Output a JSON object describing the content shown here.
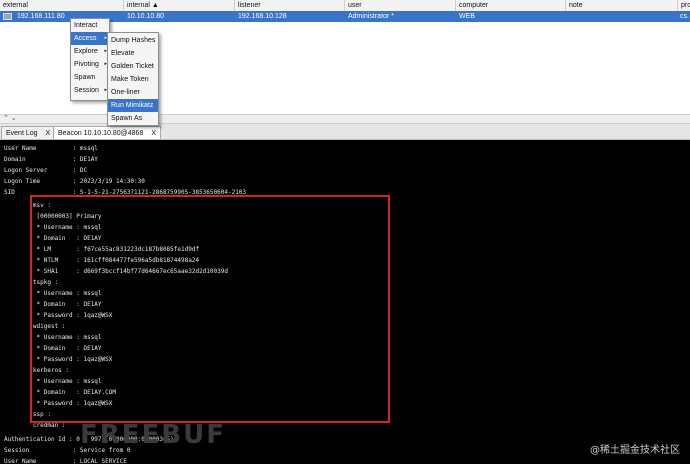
{
  "table": {
    "columns": [
      {
        "label": "external"
      },
      {
        "label": "internal ▲"
      },
      {
        "label": "listener"
      },
      {
        "label": "user"
      },
      {
        "label": "computer"
      },
      {
        "label": "note"
      },
      {
        "label": "pro"
      }
    ],
    "row": {
      "external": "192.168.111.80",
      "internal": "10.10.10.80",
      "listener": "192.168.10.128",
      "user": "Administrator *",
      "computer": "WEB",
      "process": "cs."
    }
  },
  "split_handle": "⌃ ⌄",
  "tabs": [
    {
      "label": "Event Log",
      "close": "X"
    },
    {
      "label": "Beacon 10.10.10.80@4868",
      "close": "X"
    }
  ],
  "menu_main": [
    {
      "label": "Interact",
      "arrow": ""
    },
    {
      "label": "Access",
      "arrow": "▸"
    },
    {
      "label": "Explore",
      "arrow": "▸"
    },
    {
      "label": "Pivoting",
      "arrow": "▸"
    },
    {
      "label": "Spawn",
      "arrow": ""
    },
    {
      "label": "Session",
      "arrow": "▸"
    }
  ],
  "menu_access": [
    {
      "label": "Dump Hashes"
    },
    {
      "label": "Elevate"
    },
    {
      "label": "Golden Ticket"
    },
    {
      "label": "Make Token"
    },
    {
      "label": "One-liner"
    },
    {
      "label": "Run Mimikatz"
    },
    {
      "label": "Spawn As"
    }
  ],
  "console": {
    "lines": [
      "User Name          : mssql",
      "Domain             : DE1AY",
      "Logon Server       : DC",
      "Logon Time         : 2023/3/19 14:30:30",
      "SID                : S-1-5-21-2756371121-2868759905-3853650604-2103",
      "        msv :",
      "         [00000003] Primary",
      "         * Username : mssql",
      "         * Domain   : DE1AY",
      "         * LM       : f67ce55ac831223dc187b8085fe1d9df",
      "         * NTLM     : 161cff084477fe596a5db81874498a24",
      "         * SHA1     : d669f3bccf14bf77d64667ec65aae32d2d10039d",
      "        tspkg :",
      "         * Username : mssql",
      "         * Domain   : DE1AY",
      "         * Password : 1qaz@WSX",
      "        wdigest :",
      "         * Username : mssql",
      "         * Domain   : DE1AY",
      "         * Password : 1qaz@WSX",
      "        kerberos :",
      "         * Username : mssql",
      "         * Domain   : DE1AY.COM",
      "         * Password : 1qaz@WSX",
      "        ssp :",
      "        credman :",
      "",
      "Authentication Id : 0 ; 997 (00000000:000003e5)",
      "Session            : Service from 0",
      "User Name          : LOCAL SERVICE"
    ]
  },
  "watermark": "@稀土掘金技术社区",
  "watermark_logo": "FREEBUF",
  "colors": {
    "selection": "#3874c8",
    "console_bg": "#000000",
    "highlight_box": "#d0262a"
  }
}
